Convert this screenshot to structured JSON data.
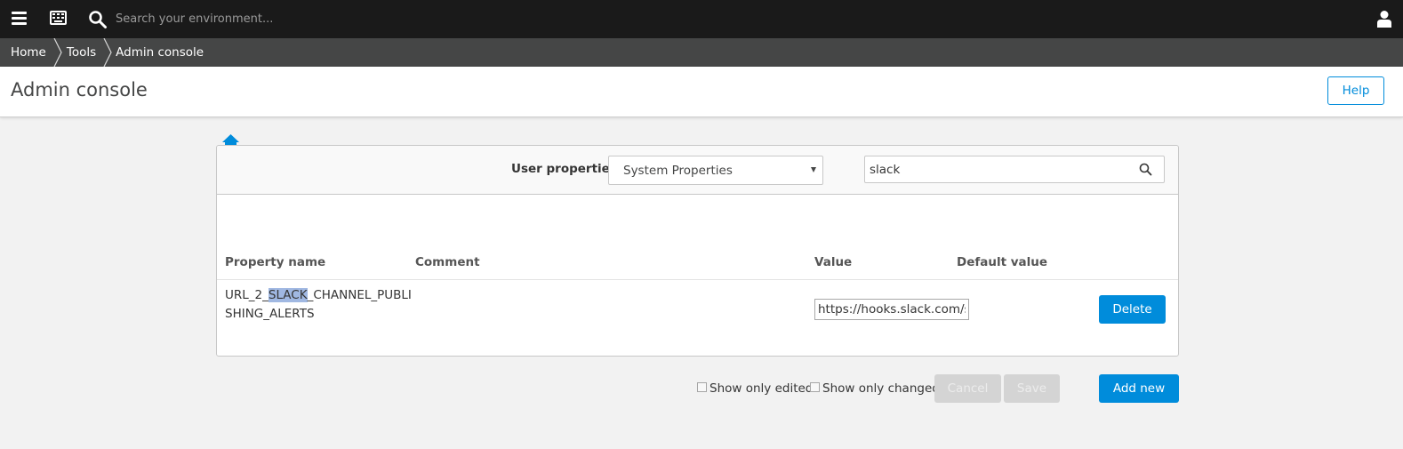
{
  "topbar": {
    "search_placeholder": "Search your environment...",
    "icons": [
      "menu-icon",
      "keyboard-icon",
      "search-icon",
      "user-icon"
    ]
  },
  "breadcrumb": {
    "items": [
      {
        "label": "Home"
      },
      {
        "label": "Tools"
      },
      {
        "label": "Admin console"
      }
    ]
  },
  "header": {
    "title": "Admin console",
    "help_label": "Help"
  },
  "filters": {
    "label": "User properties",
    "selected": "System Properties",
    "search_value": "slack"
  },
  "table": {
    "columns": [
      "Property name",
      "Comment",
      "Value",
      "Default value"
    ],
    "rows": [
      {
        "name_prefix": "URL_2_",
        "name_match": "SLACK",
        "name_suffix": "_CHANNEL_PUBLISHING_ALERTS",
        "comment": "",
        "value": "https://hooks.slack.com/se",
        "default_value": "",
        "delete_label": "Delete"
      }
    ]
  },
  "footer": {
    "show_only_edited": "Show only edited",
    "show_only_changed": "Show only changed",
    "cancel_label": "Cancel",
    "save_label": "Save",
    "add_new_label": "Add new"
  },
  "colors": {
    "accent": "#008cdb",
    "topbar": "#1a1a1a",
    "breadcrumb_bg": "#454646",
    "highlight": "#a0b8e2"
  }
}
